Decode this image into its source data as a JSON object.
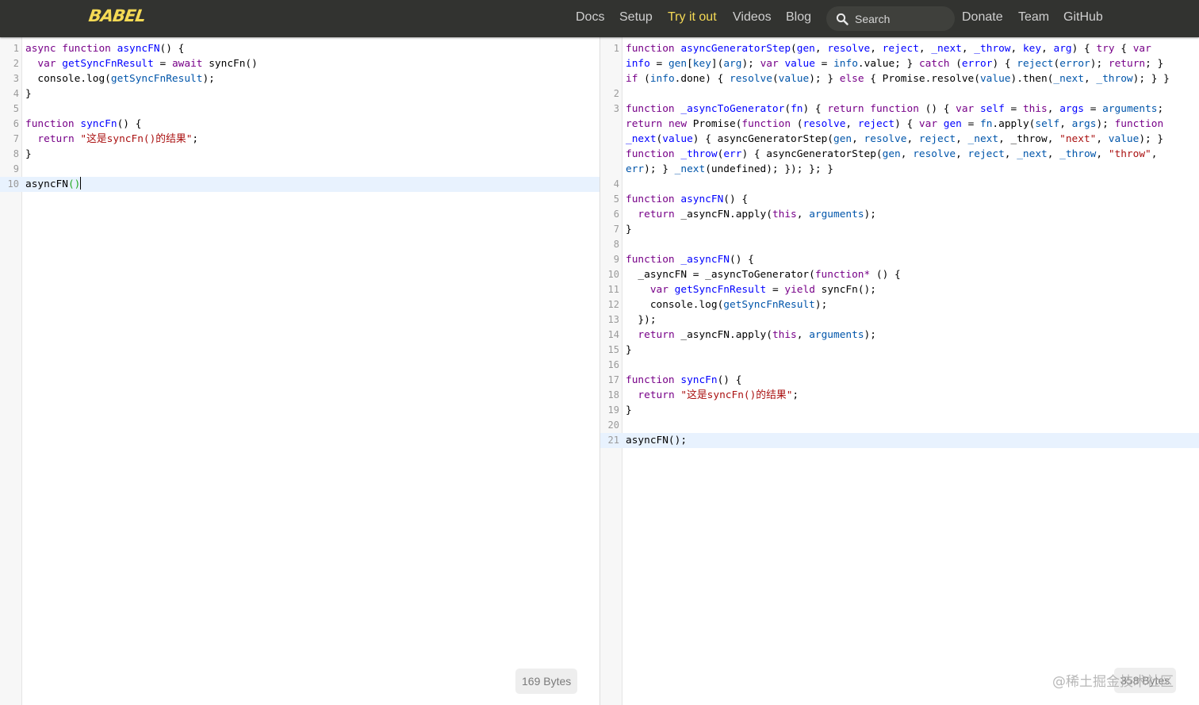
{
  "nav": {
    "logo": "BABEL",
    "items": [
      "Docs",
      "Setup",
      "Try it out",
      "Videos",
      "Blog"
    ],
    "active": "Try it out",
    "search_placeholder": "Search",
    "right_items": [
      "Donate",
      "Team",
      "GitHub"
    ],
    "accent_color": "#f5da55",
    "bar_color": "#323330"
  },
  "input_editor": {
    "line_numbers": [
      "1",
      "2",
      "3",
      "4",
      "5",
      "6",
      "7",
      "8",
      "9",
      "10"
    ],
    "size_label": "169 Bytes"
  },
  "output_editor": {
    "line_numbers": [
      "1",
      "",
      "",
      "2",
      "3",
      "",
      "",
      "",
      "",
      "4",
      "5",
      "6",
      "7",
      "8",
      "9",
      "10",
      "11",
      "12",
      "13",
      "14",
      "15",
      "16",
      "17",
      "18",
      "19",
      "20",
      "21"
    ],
    "size_label": "358 Bytes"
  },
  "watermark": "@稀土掘金技术社区",
  "syntax_colors": {
    "keyword": "#770088",
    "def": "#0000ff",
    "variable": "#0055aa",
    "string": "#aa1111"
  }
}
